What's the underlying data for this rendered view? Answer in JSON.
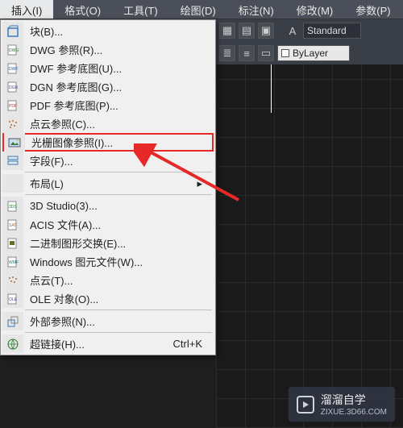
{
  "menubar": {
    "items": [
      "插入(I)",
      "格式(O)",
      "工具(T)",
      "绘图(D)",
      "标注(N)",
      "修改(M)",
      "参数(P)"
    ],
    "active_index": 0
  },
  "dropdown": {
    "groups": [
      [
        {
          "icon": "block",
          "label": "块(B)..."
        },
        {
          "icon": "dwg",
          "label": "DWG 参照(R)..."
        },
        {
          "icon": "dwf",
          "label": "DWF 参考底图(U)..."
        },
        {
          "icon": "dgn",
          "label": "DGN 参考底图(G)..."
        },
        {
          "icon": "pdf",
          "label": "PDF 参考底图(P)..."
        },
        {
          "icon": "pc",
          "label": "点云参照(C)..."
        },
        {
          "icon": "raster",
          "label": "光栅图像参照(I)...",
          "highlighted": true
        },
        {
          "icon": "field",
          "label": "字段(F)..."
        }
      ],
      [
        {
          "icon": "",
          "label": "布局(L)",
          "sub": true
        }
      ],
      [
        {
          "icon": "3ds",
          "label": "3D Studio(3)..."
        },
        {
          "icon": "acis",
          "label": "ACIS 文件(A)..."
        },
        {
          "icon": "bin",
          "label": "二进制图形交换(E)..."
        },
        {
          "icon": "wmf",
          "label": "Windows 图元文件(W)..."
        },
        {
          "icon": "pc2",
          "label": "点云(T)..."
        },
        {
          "icon": "ole",
          "label": "OLE 对象(O)..."
        }
      ],
      [
        {
          "icon": "xref",
          "label": "外部参照(N)..."
        }
      ],
      [
        {
          "icon": "link",
          "label": "超链接(H)...",
          "shortcut": "Ctrl+K"
        }
      ]
    ]
  },
  "toolbar": {
    "style_label": "Standard",
    "layer_label": "ByLayer"
  },
  "watermark": {
    "title": "溜溜自学",
    "sub": "ZIXUE.3D66.COM"
  }
}
